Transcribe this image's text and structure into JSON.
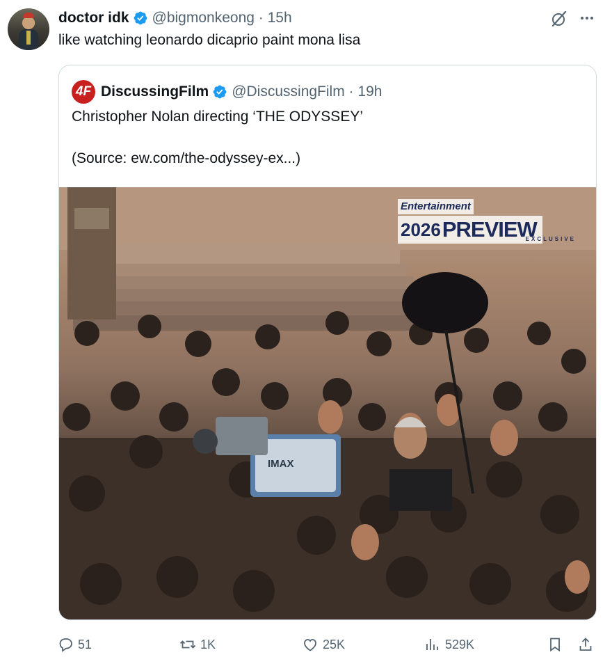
{
  "tweet": {
    "display_name": "doctor idk",
    "handle": "@bigmonkeong",
    "time": "15h",
    "text": "like watching leonardo dicaprio paint mona lisa"
  },
  "quoted": {
    "display_name": "DiscussingFilm",
    "handle": "@DiscussingFilm",
    "time": "19h",
    "line1": "Christopher Nolan directing ‘THE ODYSSEY’",
    "line2": "(Source: ew.com/the-odyssey-ex...)",
    "image_badge": {
      "top": "Entertainment",
      "year": "2026",
      "word": "PREVIEW",
      "sub": "EXCLUSIVE"
    },
    "camera_label": "IMAX"
  },
  "actions": {
    "replies": "51",
    "reposts": "1K",
    "likes": "25K",
    "views": "529K"
  },
  "colors": {
    "verified": "#1d9bf0",
    "muted": "#536471",
    "border": "#cfd9de"
  },
  "icons": [
    "grok-icon",
    "more-icon",
    "reply-icon",
    "repost-icon",
    "like-icon",
    "views-icon",
    "bookmark-icon",
    "share-icon"
  ]
}
